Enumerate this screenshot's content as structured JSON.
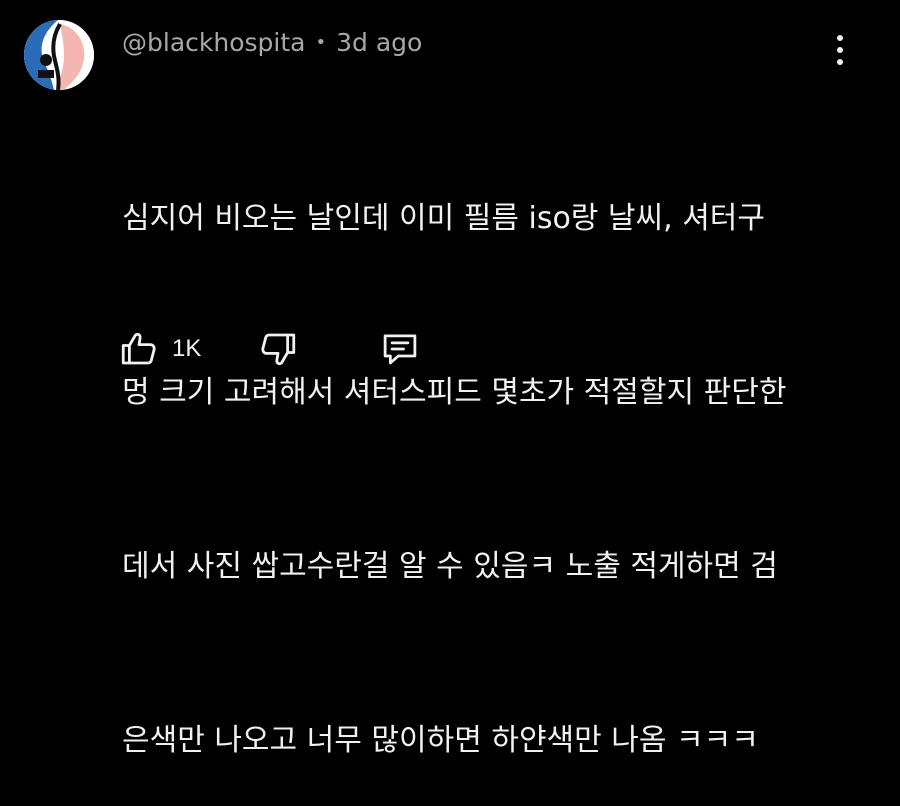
{
  "comment": {
    "author": "@blackhospita",
    "separator": "•",
    "time": "3d ago",
    "lines": [
      "심지어 비오는 날인데 이미 필름 iso랑 날씨, 셔터구",
      "멍 크기 고려해서 셔터스피드 몇초가 적절할지 판단한",
      "데서 사진 쌉고수란걸 알 수 있음ㅋ 노출 적게하면 검",
      "은색만 나오고 너무 많이하면 하얀색만 나옴 ㅋㅋㅋ"
    ]
  },
  "actions": {
    "like_icon": "thumbs-up-icon",
    "like_count": "1K",
    "dislike_icon": "thumbs-down-icon",
    "reply_icon": "comment-reply-icon",
    "more_icon": "more-vert-icon"
  },
  "colors": {
    "background": "#000000",
    "text": "#f1f1f1",
    "meta": "#a8a8a8",
    "avatar_blue": "#2b6cb8"
  }
}
